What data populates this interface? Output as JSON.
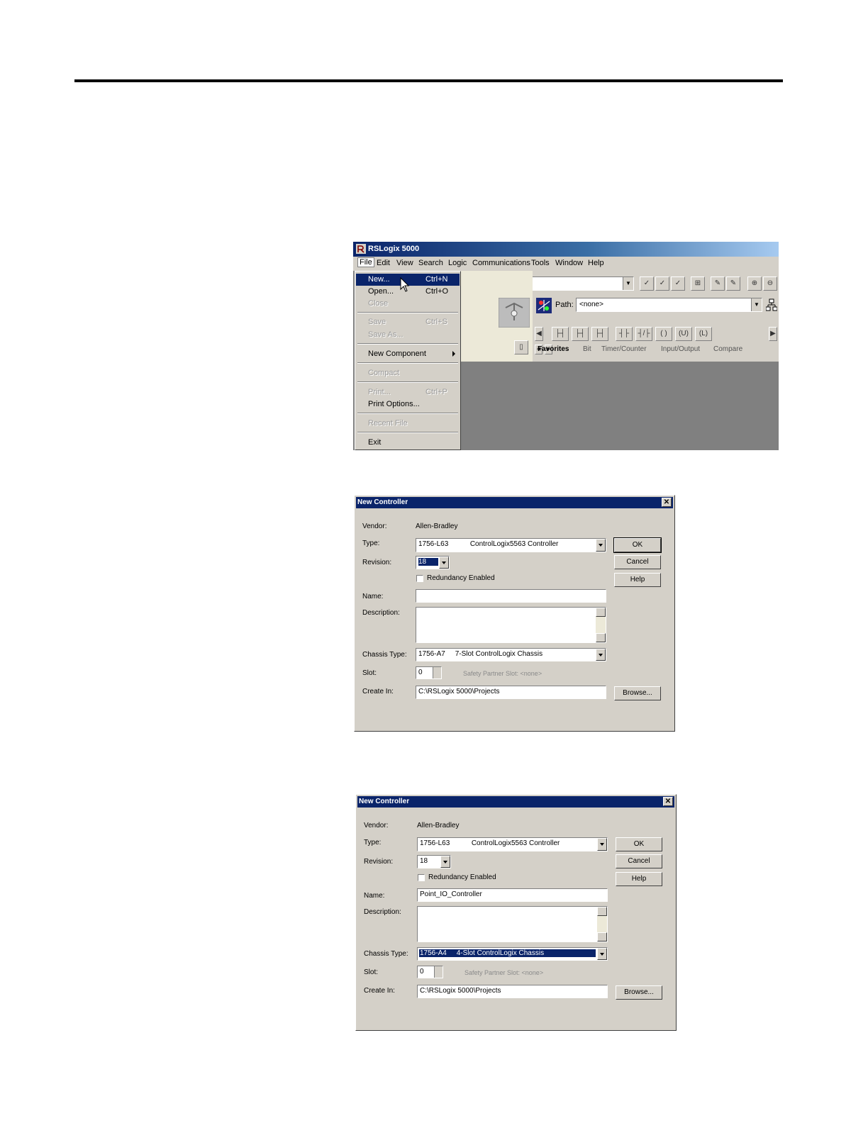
{
  "rslogix": {
    "title": "RSLogix 5000",
    "menu": [
      "File",
      "Edit",
      "View",
      "Search",
      "Logic",
      "Communications",
      "Tools",
      "Window",
      "Help"
    ],
    "path_label": "Path:",
    "path_value": "<none>",
    "tabs": [
      "Favorites",
      "Bit",
      "Timer/Counter",
      "Input/Output",
      "Compare"
    ],
    "file_menu": [
      {
        "label": "New...",
        "shortcut": "Ctrl+N",
        "state": "highlighted"
      },
      {
        "label": "Open...",
        "shortcut": "Ctrl+O",
        "state": "enabled"
      },
      {
        "label": "Close",
        "shortcut": "",
        "state": "disabled"
      },
      {
        "label": "Save",
        "shortcut": "Ctrl+S",
        "state": "disabled"
      },
      {
        "label": "Save As...",
        "shortcut": "",
        "state": "disabled"
      },
      {
        "label": "New Component",
        "shortcut": "",
        "state": "enabled"
      },
      {
        "label": "Compact",
        "shortcut": "",
        "state": "disabled"
      },
      {
        "label": "Print...",
        "shortcut": "Ctrl+P",
        "state": "disabled"
      },
      {
        "label": "Print Options...",
        "shortcut": "",
        "state": "enabled"
      },
      {
        "label": "Recent File",
        "shortcut": "",
        "state": "disabled"
      },
      {
        "label": "Exit",
        "shortcut": "",
        "state": "enabled"
      }
    ]
  },
  "dialog1": {
    "title": "New Controller",
    "vendor_label": "Vendor:",
    "vendor_value": "Allen-Bradley",
    "type_label": "Type:",
    "type_value": "1756-L63           ControlLogix5563 Controller",
    "revision_label": "Revision:",
    "revision_value": "18",
    "redundancy_label": "Redundancy Enabled",
    "name_label": "Name:",
    "name_value": "",
    "description_label": "Description:",
    "chassis_label": "Chassis Type:",
    "chassis_value": "1756-A7     7-Slot ControlLogix Chassis",
    "slot_label": "Slot:",
    "slot_value": "0",
    "safety_label": "Safety Partner Slot: <none>",
    "create_label": "Create In:",
    "create_value": "C:\\RSLogix 5000\\Projects",
    "ok": "OK",
    "cancel": "Cancel",
    "help": "Help",
    "browse": "Browse..."
  },
  "dialog2": {
    "title": "New Controller",
    "vendor_label": "Vendor:",
    "vendor_value": "Allen-Bradley",
    "type_label": "Type:",
    "type_value": "1756-L63           ControlLogix5563 Controller",
    "revision_label": "Revision:",
    "revision_value": "18",
    "redundancy_label": "Redundancy Enabled",
    "name_label": "Name:",
    "name_value": "Point_IO_Controller",
    "description_label": "Description:",
    "chassis_label": "Chassis Type:",
    "chassis_value": "1756-A4     4-Slot ControlLogix Chassis",
    "slot_label": "Slot:",
    "slot_value": "0",
    "safety_label": "Safety Partner Slot: <none>",
    "create_label": "Create In:",
    "create_value": "C:\\RSLogix 5000\\Projects",
    "ok": "OK",
    "cancel": "Cancel",
    "help": "Help",
    "browse": "Browse..."
  }
}
